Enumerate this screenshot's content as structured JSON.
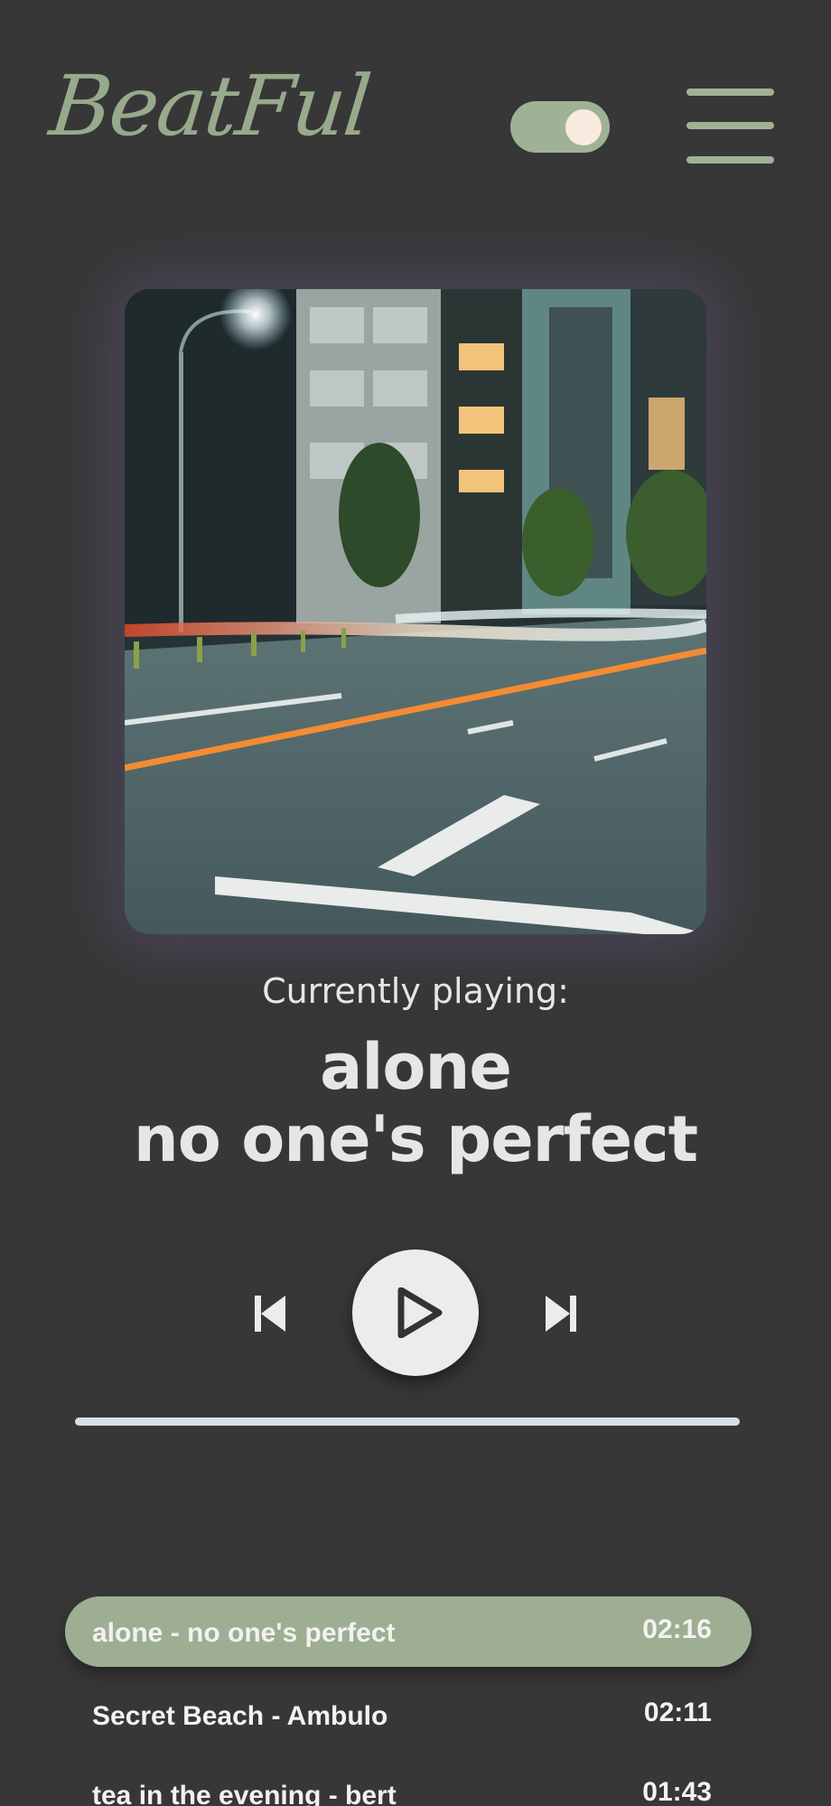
{
  "header": {
    "logo_text": "BeatFul",
    "theme_toggle": {
      "on": true
    },
    "menu_icon": "hamburger-menu-icon"
  },
  "player": {
    "album_art": {
      "alt": "night city street with light trails"
    },
    "now_playing_label": "Currently playing:",
    "track_name": "alone",
    "artist_name": "no one's perfect",
    "controls": {
      "prev_icon": "skip-previous-icon",
      "play_icon": "play-icon",
      "next_icon": "skip-next-icon"
    },
    "progress": 0
  },
  "playlist": {
    "items": [
      {
        "title": "alone - no one's perfect",
        "duration": "02:16",
        "active": true
      },
      {
        "title": "Secret Beach - Ambulo",
        "duration": "02:11",
        "active": false
      },
      {
        "title": "tea in the evening - bert",
        "duration": "01:43",
        "active": false
      }
    ]
  },
  "colors": {
    "background": "#373737",
    "accent": "#9eae92",
    "logo": "#97aa8c",
    "text": "#e6e6e6",
    "knob": "#f7ecdf"
  }
}
